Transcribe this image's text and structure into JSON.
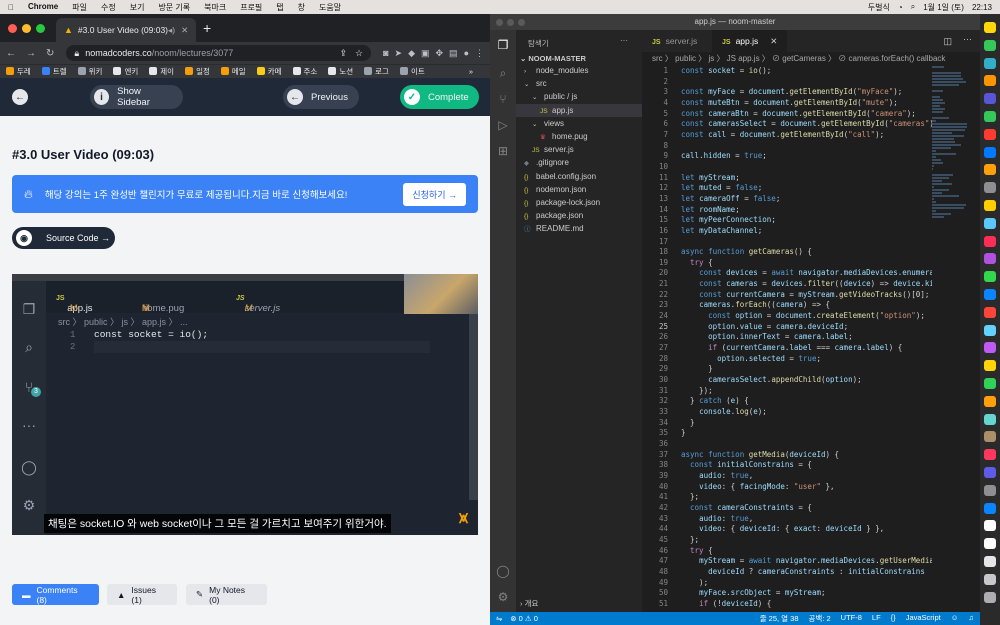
{
  "menubar": {
    "items": [
      "Chrome",
      "파일",
      "수정",
      "보기",
      "방문 기록",
      "북마크",
      "프로필",
      "탭",
      "창",
      "도움말"
    ],
    "right": [
      "두벌식",
      "1월 1일 (토)",
      "22:13"
    ]
  },
  "chrome": {
    "tab_title": "#3.0 User Video (09:03)",
    "url_domain": "nomadcoders.co",
    "url_path": "/noom/lectures/3077",
    "bookmarks": [
      "두레",
      "트렐",
      "위키",
      "엔키",
      "제이",
      "일정",
      "메일",
      "카메",
      "주소",
      "노션",
      "로그",
      "이트"
    ]
  },
  "lecture": {
    "show_sidebar": "Show Sidebar",
    "previous": "Previous",
    "complete": "Complete",
    "title": "#3.0 User Video (09:03)",
    "banner_text": "해당 강의는 1주 완성반 챌린지가 무료로 제공됩니다.지금 바로 신청해보세요!",
    "banner_cta": "신청하기 →",
    "source_code": "Source Code →",
    "comments": "Comments (8)",
    "issues": "Issues (1)",
    "notes": "My Notes (0)"
  },
  "video": {
    "tab1": "app.js",
    "tab1_mod": "M",
    "tab2": "home.pug",
    "tab2_mod": "M",
    "tab3": "server.js",
    "tab3_mod": "M",
    "breadcrumb": "src 〉 public 〉 js 〉 app.js 〉 ...",
    "code_line1": "const socket = io();",
    "badge": "3",
    "subtitle": "채팅은 socket.IO 와 web socket이나 그 모든 걸 가르치고 보여주기 위한거야."
  },
  "vscode": {
    "window_title": "app.js — noom-master",
    "explorer_header": "탐색기",
    "project": "NOOM-MASTER",
    "tree": [
      {
        "label": "node_modules",
        "depth": 1,
        "kind": "folder-closed"
      },
      {
        "label": "src",
        "depth": 1,
        "kind": "folder-open"
      },
      {
        "label": "public / js",
        "depth": 2,
        "kind": "folder-open"
      },
      {
        "label": "app.js",
        "depth": 3,
        "kind": "js",
        "selected": true
      },
      {
        "label": "views",
        "depth": 2,
        "kind": "folder-open"
      },
      {
        "label": "home.pug",
        "depth": 3,
        "kind": "pug"
      },
      {
        "label": "server.js",
        "depth": 2,
        "kind": "js"
      },
      {
        "label": ".gitignore",
        "depth": 1,
        "kind": "dot"
      },
      {
        "label": "babel.config.json",
        "depth": 1,
        "kind": "json"
      },
      {
        "label": "nodemon.json",
        "depth": 1,
        "kind": "json"
      },
      {
        "label": "package-lock.json",
        "depth": 1,
        "kind": "json"
      },
      {
        "label": "package.json",
        "depth": 1,
        "kind": "json"
      },
      {
        "label": "README.md",
        "depth": 1,
        "kind": "md"
      }
    ],
    "outline": "개요",
    "tab_server": "server.js",
    "tab_app": "app.js",
    "breadcrumb": "src 〉 public 〉 js 〉 JS app.js 〉 ⊘ getCameras 〉 ⊘ cameras.forEach() callback",
    "current_line": 25,
    "code": [
      "const socket = io();",
      "",
      "const myFace = document.getElementById(\"myFace\");",
      "const muteBtn = document.getElementById(\"mute\");",
      "const cameraBtn = document.getElementById(\"camera\");",
      "const camerasSelect = document.getElementById(\"cameras\");",
      "const call = document.getElementById(\"call\");",
      "",
      "call.hidden = true;",
      "",
      "let myStream;",
      "let muted = false;",
      "let cameraOff = false;",
      "let roomName;",
      "let myPeerConnection;",
      "let myDataChannel;",
      "",
      "async function getCameras() {",
      "  try {",
      "    const devices = await navigator.mediaDevices.enumerate",
      "    const cameras = devices.filter((device) => device.kind",
      "    const currentCamera = myStream.getVideoTracks()[0];",
      "    cameras.forEach((camera) => {",
      "      const option = document.createElement(\"option\");",
      "      option.value = camera.deviceId;",
      "      option.innerText = camera.label;",
      "      if (currentCamera.label === camera.label) {",
      "        option.selected = true;",
      "      }",
      "      camerasSelect.appendChild(option);",
      "    });",
      "  } catch (e) {",
      "    console.log(e);",
      "  }",
      "}",
      "",
      "async function getMedia(deviceId) {",
      "  const initialConstrains = {",
      "    audio: true,",
      "    video: { facingMode: \"user\" },",
      "  };",
      "  const cameraConstraints = {",
      "    audio: true,",
      "    video: { deviceId: { exact: deviceId } },",
      "  };",
      "  try {",
      "    myStream = await navigator.mediaDevices.getUserMedia(",
      "      deviceId ? cameraConstraints : initialConstrains",
      "    );",
      "    myFace.srcObject = myStream;",
      "    if (!deviceId) {"
    ],
    "status": {
      "errors": "⊗ 0  ⚠ 0",
      "position": "줄 25, 열 38",
      "spaces": "공백: 2",
      "encoding": "UTF-8",
      "eol": "LF",
      "language": "JavaScript"
    }
  },
  "colors": {
    "keyword": "#569cd6",
    "function": "#dcdcaa",
    "string": "#ce9178",
    "variable": "#9cdcfe",
    "accent": "#007acc",
    "complete_green": "#10b981",
    "banner_blue": "#3b82f6"
  }
}
